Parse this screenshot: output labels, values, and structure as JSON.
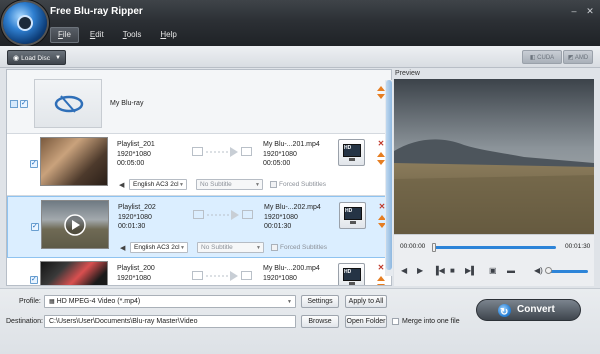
{
  "window": {
    "title": "Free Blu-ray Ripper",
    "controls": {
      "minimize": "–",
      "close": "✕"
    }
  },
  "menu": [
    {
      "label": "File",
      "accel": "F",
      "rest": "ile"
    },
    {
      "label": "Edit",
      "accel": "E",
      "rest": "dit"
    },
    {
      "label": "Tools",
      "accel": "T",
      "rest": "ools"
    },
    {
      "label": "Help",
      "accel": "H",
      "rest": "elp"
    }
  ],
  "toolbar": {
    "load_disc": "Load Disc",
    "gpu": [
      {
        "label": "CUDA"
      },
      {
        "label": "AMD"
      }
    ]
  },
  "disc": {
    "name": "My Blu-ray"
  },
  "titles": [
    {
      "name": "Playlist_201",
      "resolution": "1920*1080",
      "duration": "00:05:00",
      "output_name": "My Blu-...201.mp4",
      "output_resolution": "1920*1080",
      "output_duration": "00:05:00",
      "audio": "English AC3 2cl",
      "subtitle": "No Subtitle",
      "forced_subtitles": "Forced Subtitles"
    },
    {
      "name": "Playlist_202",
      "resolution": "1920*1080",
      "duration": "00:01:30",
      "output_name": "My Blu-...202.mp4",
      "output_resolution": "1920*1080",
      "output_duration": "00:01:30",
      "audio": "English AC3 2cl",
      "subtitle": "No Subtitle",
      "forced_subtitles": "Forced Subtitles"
    },
    {
      "name": "Playlist_200",
      "resolution": "1920*1080",
      "duration": "",
      "output_name": "My Blu-...200.mp4",
      "output_resolution": "1920*1080",
      "output_duration": "",
      "audio": "",
      "subtitle": "",
      "forced_subtitles": ""
    }
  ],
  "preview": {
    "label": "Preview",
    "time_current": "00:00:00",
    "time_total": "00:01:30"
  },
  "bottom": {
    "profile_label": "Profile:",
    "profile_value": "HD MPEG-4 Video (*.mp4)",
    "settings": "Settings",
    "apply_all": "Apply to All",
    "destination_label": "Destination:",
    "destination_value": "C:\\Users\\User\\Documents\\Blu-ray Master\\Video",
    "browse": "Browse",
    "open_folder": "Open Folder",
    "merge": "Merge into one file",
    "convert": "Convert"
  },
  "colors": {
    "accent": "#2d84d8",
    "selection": "#dbeeff",
    "remove": "#c0392b"
  },
  "icons": {
    "logo": "blu-ray-disc-logo",
    "play": "play-icon",
    "format": "hd-monitor-icon",
    "volume": "speaker-icon"
  }
}
